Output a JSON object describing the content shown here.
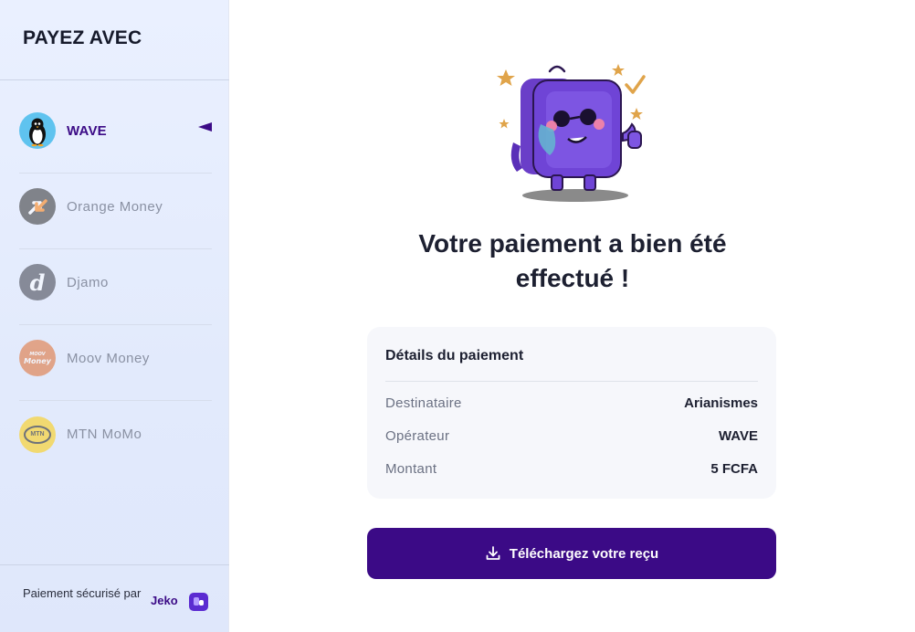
{
  "sidebar": {
    "title": "PAYEZ AVEC",
    "methods": [
      {
        "label": "WAVE",
        "active": true,
        "icon": "penguin-icon"
      },
      {
        "label": "Orange Money",
        "active": false,
        "icon": "orange-money-arrows-icon"
      },
      {
        "label": "Djamo",
        "active": false,
        "icon": "djamo-d-icon",
        "glyph": "d"
      },
      {
        "label": "Moov Money",
        "active": false,
        "icon": "moov-money-icon",
        "glyph_top": "MOOV",
        "glyph": "Money"
      },
      {
        "label": "MTN MoMo",
        "active": false,
        "icon": "mtn-icon",
        "glyph": "MTN"
      }
    ],
    "footer": {
      "secure_text": "Paiement sécurisé par",
      "brand": "Jeko",
      "brand_icon": "jeko-logo-icon"
    }
  },
  "main": {
    "mascot_icon": "happy-wallet-mascot-icon",
    "title": "Votre paiement a bien été effectué !",
    "details": {
      "heading": "Détails du paiement",
      "rows": [
        {
          "key": "Destinataire",
          "value": "Arianismes"
        },
        {
          "key": "Opérateur",
          "value": "WAVE"
        },
        {
          "key": "Montant",
          "value": "5 FCFA"
        }
      ]
    },
    "download_button": {
      "label": "Téléchargez votre reçu",
      "icon": "download-icon"
    }
  },
  "colors": {
    "accent": "#3b0a86",
    "sidebar_bg": "#e2eafc",
    "card_bg": "#f6f7fb"
  }
}
